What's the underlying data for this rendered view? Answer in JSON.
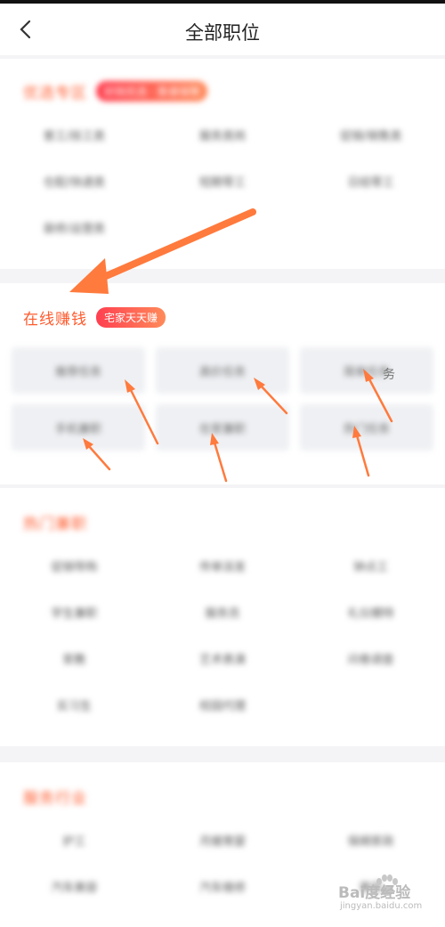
{
  "header": {
    "title": "全部职位",
    "back_icon": "chevron-left-icon"
  },
  "sections": {
    "s1": {
      "title": "优选专区",
      "badge": "好岗优选 · 靠谱保障",
      "items": [
        "普工/技工类",
        "服务类岗",
        "促销/销售类",
        "仓配/快递类",
        "短期零工",
        "日结零工",
        "装修/运营类"
      ]
    },
    "s2": {
      "title": "在线赚钱",
      "badge": "宅家天天赚",
      "items": [
        "推荐任务",
        "高价任务",
        "简单任务",
        "手机兼职",
        "在家兼职",
        "热门任务"
      ],
      "stray_text": "务"
    },
    "s3": {
      "title": "热门兼职",
      "items": [
        "促销导购",
        "传单派发",
        "钟点工",
        "学生兼职",
        "服务员",
        "礼仪模特",
        "家教",
        "艺术表演",
        "问卷调查",
        "实习生",
        "校园代理"
      ]
    },
    "s4": {
      "title": "服务行业",
      "items": [
        "护工",
        "月嫂育婴",
        "保姆家政",
        "汽车美容",
        "汽车维修",
        "美容"
      ]
    }
  },
  "watermark": {
    "main": "Bai度经验",
    "sub": "jingyan.baidu.com"
  },
  "colors": {
    "accent": "#ff5a2c",
    "arrow": "#ff7a3d",
    "badge_start": "#ff3f50",
    "badge_end": "#ff8a5a"
  }
}
